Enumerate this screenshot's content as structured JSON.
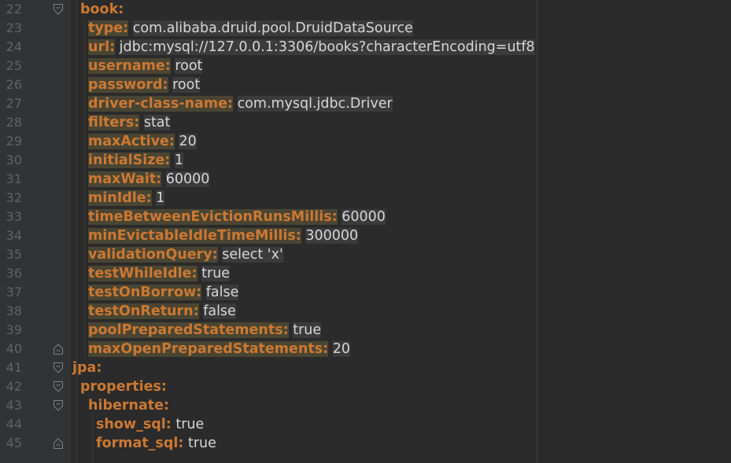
{
  "lines": [
    {
      "n": "22",
      "indent": 0,
      "key": "book:",
      "value": "",
      "fold": "open"
    },
    {
      "n": "23",
      "indent": 1,
      "key": "type:",
      "value": "com.alibaba.druid.pool.DruidDataSource",
      "fold": ""
    },
    {
      "n": "24",
      "indent": 1,
      "key": "url:",
      "value": "jdbc:mysql://127.0.0.1:3306/books?characterEncoding=utf8",
      "fold": ""
    },
    {
      "n": "25",
      "indent": 1,
      "key": "username:",
      "value": "root",
      "fold": ""
    },
    {
      "n": "26",
      "indent": 1,
      "key": "password:",
      "value": "root",
      "fold": ""
    },
    {
      "n": "27",
      "indent": 1,
      "key": "driver-class-name:",
      "value": "com.mysql.jdbc.Driver",
      "fold": ""
    },
    {
      "n": "28",
      "indent": 1,
      "key": "filters:",
      "value": "stat",
      "fold": ""
    },
    {
      "n": "29",
      "indent": 1,
      "key": "maxActive:",
      "value": "20",
      "fold": ""
    },
    {
      "n": "30",
      "indent": 1,
      "key": "initialSize:",
      "value": "1",
      "fold": ""
    },
    {
      "n": "31",
      "indent": 1,
      "key": "maxWait:",
      "value": "60000",
      "fold": ""
    },
    {
      "n": "32",
      "indent": 1,
      "key": "minIdle:",
      "value": "1",
      "fold": ""
    },
    {
      "n": "33",
      "indent": 1,
      "key": "timeBetweenEvictionRunsMillis:",
      "value": "60000",
      "fold": ""
    },
    {
      "n": "34",
      "indent": 1,
      "key": "minEvictableIdleTimeMillis:",
      "value": "300000",
      "fold": ""
    },
    {
      "n": "35",
      "indent": 1,
      "key": "validationQuery:",
      "value": "select 'x'",
      "fold": ""
    },
    {
      "n": "36",
      "indent": 1,
      "key": "testWhileIdle:",
      "value": "true",
      "fold": ""
    },
    {
      "n": "37",
      "indent": 1,
      "key": "testOnBorrow:",
      "value": "false",
      "fold": ""
    },
    {
      "n": "38",
      "indent": 1,
      "key": "testOnReturn:",
      "value": "false",
      "fold": ""
    },
    {
      "n": "39",
      "indent": 1,
      "key": "poolPreparedStatements:",
      "value": "true",
      "fold": ""
    },
    {
      "n": "40",
      "indent": 1,
      "key": "maxOpenPreparedStatements:",
      "value": "20",
      "fold": "close"
    },
    {
      "n": "41",
      "indent": -1,
      "key": "jpa:",
      "value": "",
      "fold": "open"
    },
    {
      "n": "42",
      "indent": 0,
      "key": "properties:",
      "value": "",
      "fold": "open"
    },
    {
      "n": "43",
      "indent": 1,
      "key": "hibernate:",
      "value": "",
      "fold": "open"
    },
    {
      "n": "44",
      "indent": 2,
      "key": "show_sql:",
      "value": "true",
      "fold": ""
    },
    {
      "n": "45",
      "indent": 2,
      "key": "format_sql:",
      "value": "true",
      "fold": "close"
    }
  ]
}
